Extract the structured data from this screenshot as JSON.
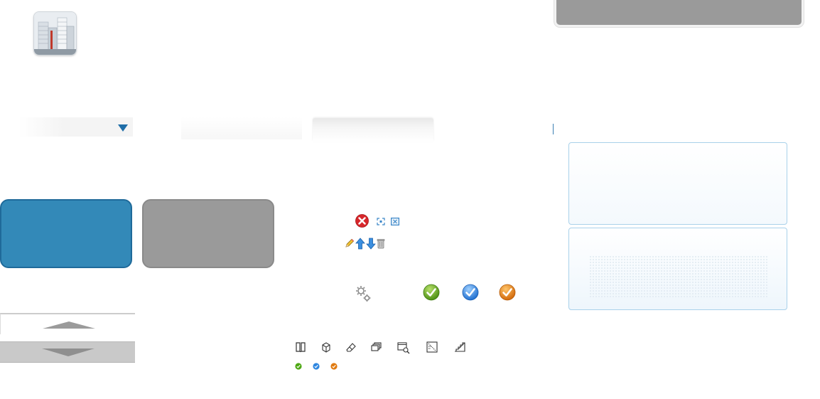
{
  "colors": {
    "accent_blue": "#3389b8",
    "neutral_grey": "#9a9a9a",
    "panel_border": "#a9d1ea",
    "check_green": "#5da21c",
    "check_blue": "#2f86df",
    "check_orange": "#e07a10"
  },
  "thumbnail": {
    "icon": "building-photo"
  },
  "dropdown": {
    "icon": "triangle-down-icon"
  },
  "action_icons_row1": [
    "delete-red-icon",
    "fit-view-icon",
    "close-box-icon"
  ],
  "action_icons_row2": [
    "pencil-icon",
    "arrow-up-icon",
    "arrow-down-icon",
    "trash-can-icon"
  ],
  "status_icons": [
    "gears-icon",
    "check-green-icon",
    "check-blue-icon",
    "check-orange-icon"
  ],
  "toolbar_icons": [
    "book-icon",
    "cube-icon",
    "eraser-icon",
    "layers-icon",
    "window-search-icon",
    "grid-chart-icon",
    "stairs-icon"
  ],
  "small_checks": [
    "check-green-small-icon",
    "check-blue-small-icon",
    "check-orange-small-icon"
  ]
}
